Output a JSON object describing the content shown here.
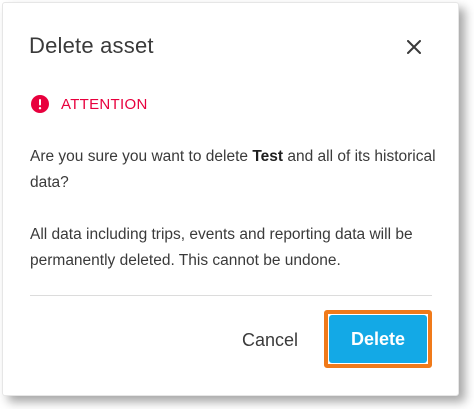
{
  "dialog": {
    "title": "Delete asset",
    "close_icon": "close-icon",
    "attention": {
      "icon": "alert-circle-icon",
      "label": "ATTENTION",
      "color": "#e8003d"
    },
    "confirm_prefix": "Are you sure you want to delete ",
    "asset_name": "Test",
    "confirm_suffix": " and all of its historical data?",
    "warning": "All data including trips, events and reporting data will be permanently deleted. This cannot be undone.",
    "cancel_label": "Cancel",
    "delete_label": "Delete",
    "delete_color": "#13a9e6",
    "highlight_color": "#f07a1a"
  }
}
